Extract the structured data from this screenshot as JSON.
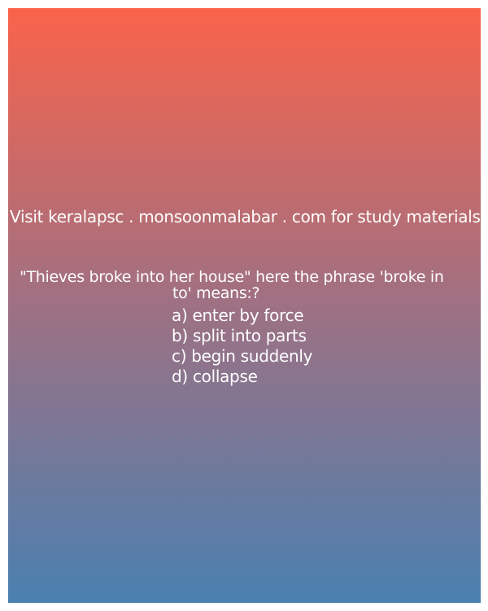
{
  "colors": {
    "gradient_top": "#fa634a",
    "gradient_middle": "#9e7183",
    "gradient_bottom": "#4a80b0",
    "text": "#ffffff"
  },
  "site_notice": "Visit keralapsc . monsoonmalabar . com for study materials",
  "question": {
    "line1": "\"Thieves broke into her house\" here the phrase 'broke in",
    "line2": "to' means:?"
  },
  "options": [
    "a) enter by force",
    "b) split into parts",
    "c) begin suddenly",
    "d) collapse"
  ]
}
